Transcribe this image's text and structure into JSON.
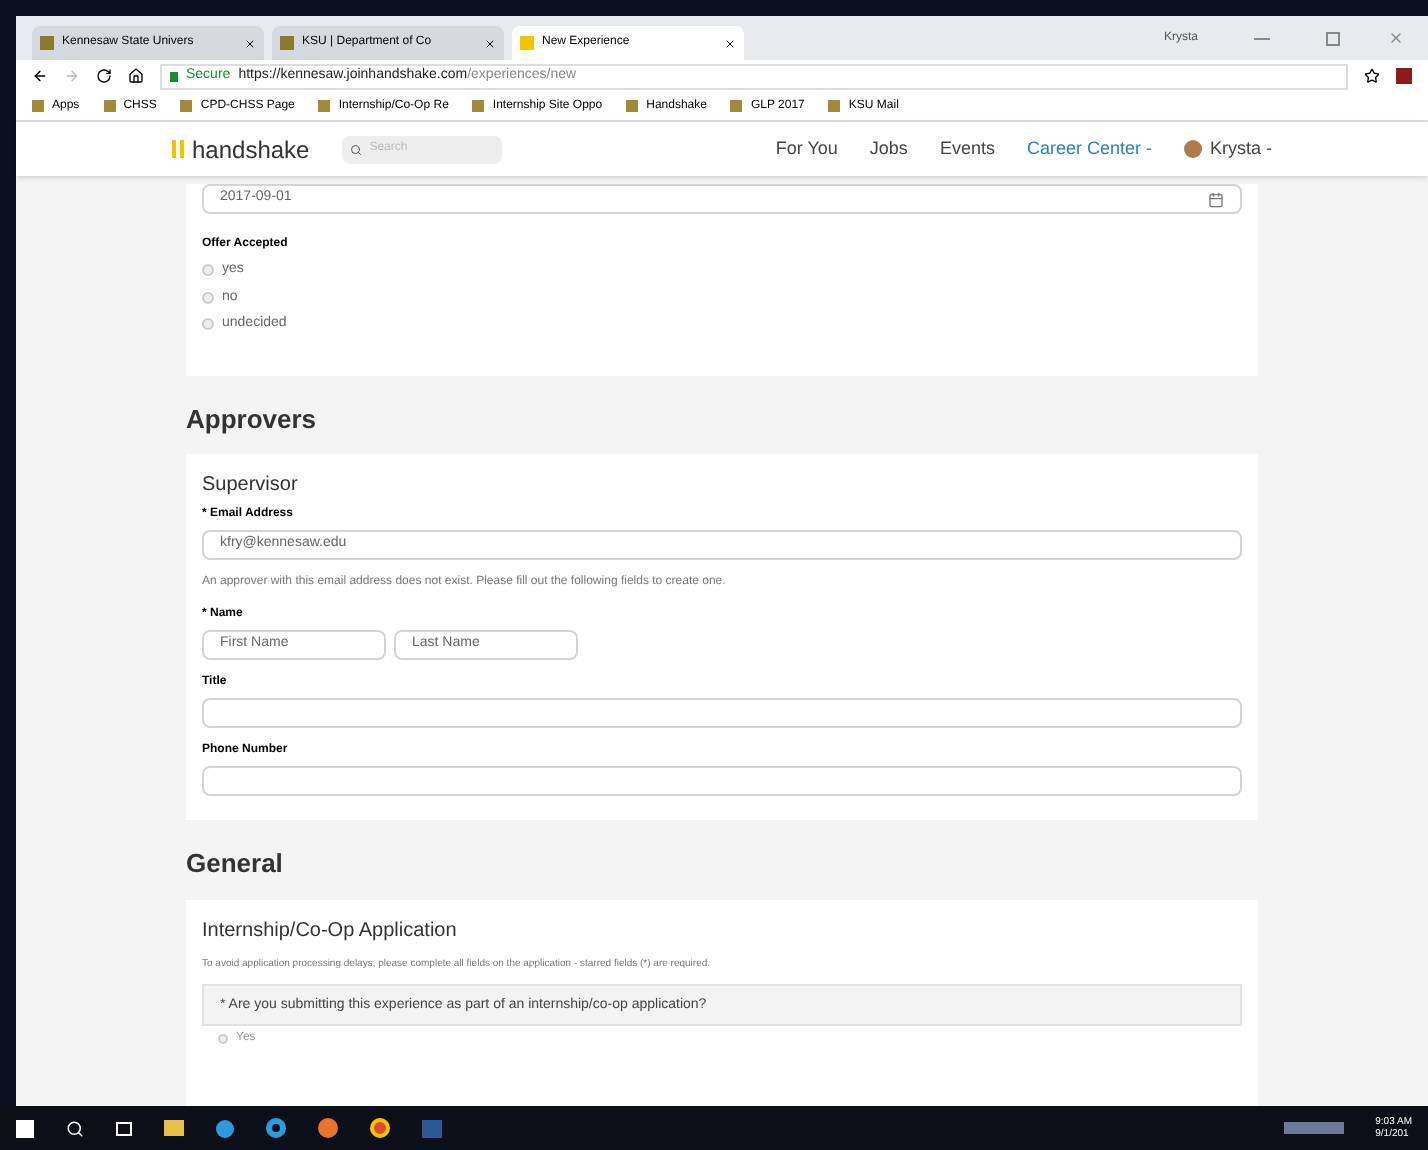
{
  "browser": {
    "tabs": [
      {
        "title": "Kennesaw State Univers",
        "selected": false
      },
      {
        "title": "KSU | Department of Co",
        "selected": false
      },
      {
        "title": "New Experience",
        "selected": true
      }
    ],
    "user": "Krysta",
    "secure_label": "Secure",
    "url_host": "https://kennesaw.joinhandshake.com",
    "url_path": "/experiences/new",
    "bookmarks": [
      "Apps",
      "CHSS",
      "CPD-CHSS Page",
      "Internship/Co-Op Re",
      "Internship Site Oppo",
      "Handshake",
      "GLP 2017",
      "KSU Mail"
    ]
  },
  "nav": {
    "logo": "handshake",
    "search_placeholder": "Search",
    "links": [
      {
        "label": "For You",
        "selected": false
      },
      {
        "label": "Jobs",
        "selected": false
      },
      {
        "label": "Events",
        "selected": false
      },
      {
        "label": "Career Center -",
        "selected": true
      }
    ],
    "user": "Krysta -"
  },
  "offer": {
    "date": "2017-09-01",
    "label": "Offer Accepted",
    "options": [
      {
        "label": "yes",
        "selected": false
      },
      {
        "label": "no",
        "selected": false
      },
      {
        "label": "undecided",
        "selected": false
      }
    ]
  },
  "approvers": {
    "heading": "Approvers",
    "card_title": "Supervisor",
    "email_label": "* Email Address",
    "email_value": "kfry@kennesaw.edu",
    "notice": "An approver with this email address does not exist. Please fill out the following fields to create one.",
    "name_label": "* Name",
    "first_placeholder": "First Name",
    "last_placeholder": "Last Name",
    "title_label": "Title",
    "phone_label": "Phone Number"
  },
  "general": {
    "heading": "General",
    "card_title": "Internship/Co-Op Application",
    "notice": "To avoid application processing delays, please complete all fields on the application - starred fields (*) are required.",
    "question": "* Are you submitting this experience as part of an internship/co-op application?",
    "option": {
      "label": "Yes",
      "selected": false
    }
  },
  "taskbar": {
    "time": "9:03 AM",
    "date": "9/1/201"
  }
}
